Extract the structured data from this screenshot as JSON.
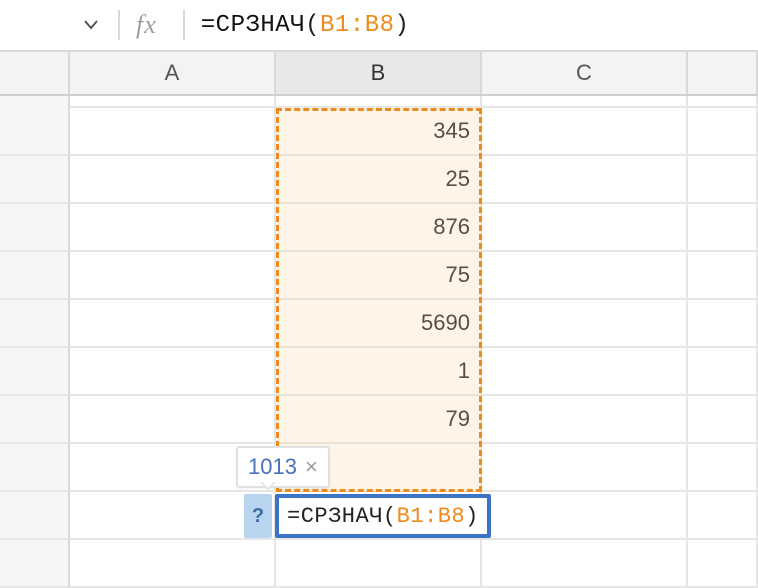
{
  "formulaBar": {
    "fxLabel": "fx",
    "eq": "=",
    "fnName": "СРЗНАЧ",
    "lparen": "(",
    "range": "B1:B8",
    "rparen": ")"
  },
  "columns": {
    "A": "A",
    "B": "B",
    "C": "C"
  },
  "cells": {
    "B1": "345",
    "B2": "25",
    "B3": "876",
    "B4": "75",
    "B5": "5690",
    "B6": "1",
    "B7": "79",
    "B8": ""
  },
  "activeCell": {
    "helper": "?",
    "eq": "=",
    "fnName": "СРЗНАЧ",
    "lparen": "(",
    "range": "B1:B8",
    "rparen": ")"
  },
  "preview": {
    "value": "1013",
    "close": "×"
  },
  "selection": {
    "ref": "B1:B8"
  }
}
